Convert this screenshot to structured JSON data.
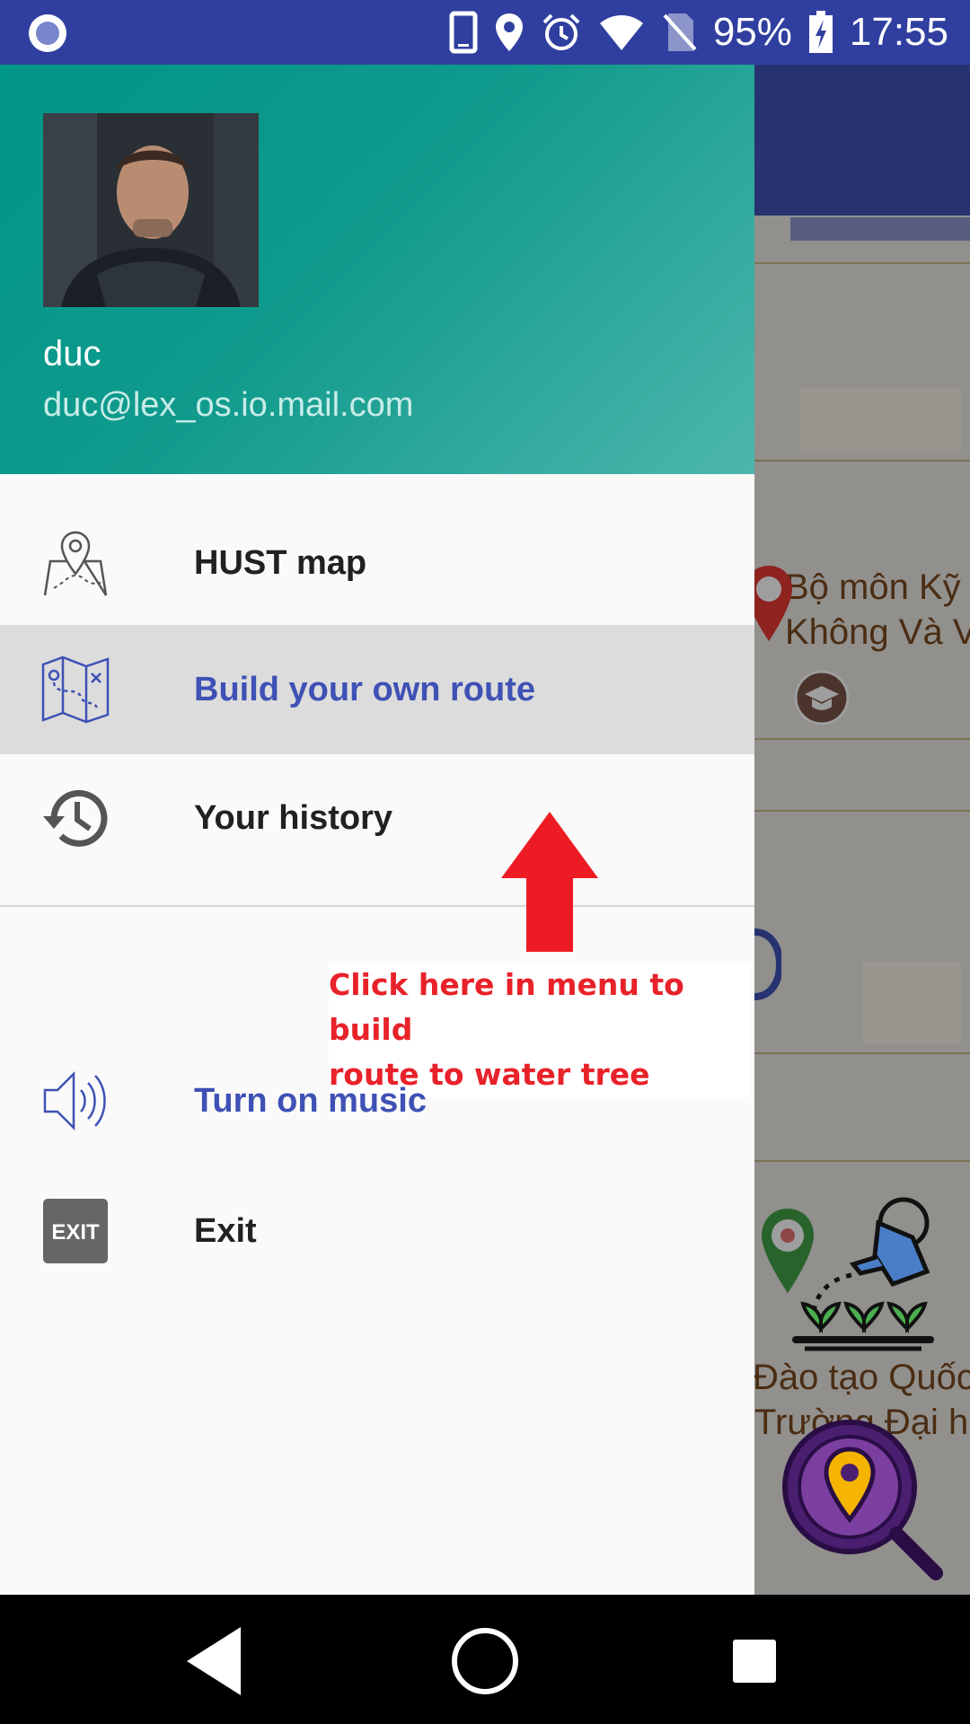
{
  "status_bar": {
    "battery": "95%",
    "time": "17:55",
    "icons": [
      "app-notification-icon",
      "phone-icon",
      "location-icon",
      "alarm-icon",
      "wifi-icon",
      "no-sim-icon",
      "battery-charging-icon"
    ]
  },
  "drawer": {
    "header": {
      "name": "duc",
      "email": "duc@lex_os.io.mail.com"
    },
    "items": [
      {
        "label": "HUST map",
        "icon": "map-pin-icon",
        "active": false
      },
      {
        "label": "Build your own route",
        "icon": "folded-map-route-icon",
        "active": true
      },
      {
        "label": "Your history",
        "icon": "history-icon",
        "active": false
      },
      {
        "label": "Turn on music",
        "icon": "speaker-icon",
        "active": false
      },
      {
        "label": "Exit",
        "icon": "exit-sign-icon",
        "active": false
      }
    ]
  },
  "annotation": {
    "text_line1": "Click here in menu to build",
    "text_line2": "route to water tree",
    "arrow": "up"
  },
  "map_background": {
    "labels": [
      "Bộ môn Kỹ",
      "Không Và V",
      "Đào tạo Quốc",
      "Trường Đại họ"
    ]
  },
  "colors": {
    "status_bar": "#303f9f",
    "header_start": "#009688",
    "header_end": "#4db6ac",
    "accent": "#3f51b5",
    "annotation": "#e8222a",
    "active_item": "#dcdcdc"
  },
  "nav_bar": {
    "buttons": [
      "back-icon",
      "home-icon",
      "recents-icon"
    ]
  }
}
